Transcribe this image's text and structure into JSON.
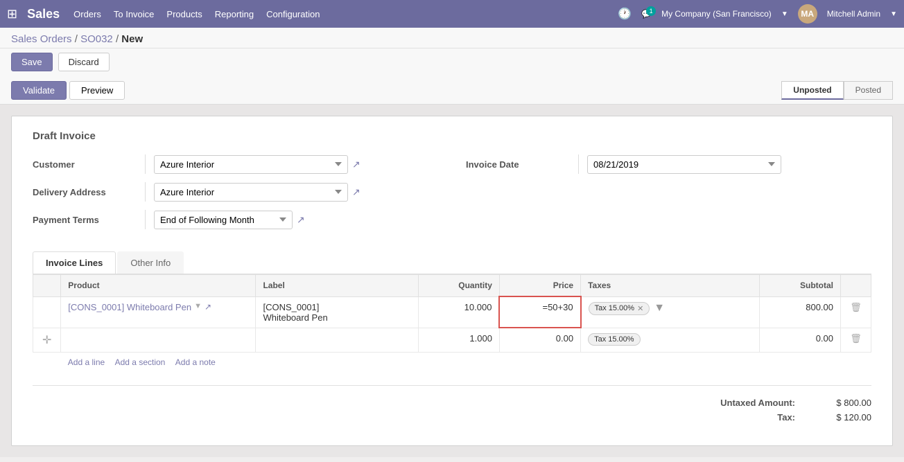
{
  "app": {
    "name": "Sales",
    "grid_icon": "⊞"
  },
  "navbar": {
    "menu_items": [
      "Orders",
      "To Invoice",
      "Products",
      "Reporting",
      "Configuration"
    ],
    "company": "My Company (San Francisco)",
    "user": "Mitchell Admin",
    "chat_badge": "1"
  },
  "breadcrumb": {
    "parts": [
      "Sales Orders",
      "SO032",
      "New"
    ],
    "separators": [
      "/",
      "/"
    ]
  },
  "action_bar": {
    "save_label": "Save",
    "discard_label": "Discard"
  },
  "form_actions": {
    "validate_label": "Validate",
    "preview_label": "Preview"
  },
  "status_bar": {
    "unposted_label": "Unposted",
    "posted_label": "Posted",
    "active": "Unposted"
  },
  "form": {
    "title": "Draft Invoice",
    "customer_label": "Customer",
    "customer_value": "Azure Interior",
    "delivery_address_label": "Delivery Address",
    "delivery_address_value": "Azure Interior",
    "payment_terms_label": "Payment Terms",
    "payment_terms_value": "End of Following Month",
    "invoice_date_label": "Invoice Date",
    "invoice_date_value": "08/21/2019"
  },
  "tabs": [
    {
      "id": "invoice-lines",
      "label": "Invoice Lines",
      "active": true
    },
    {
      "id": "other-info",
      "label": "Other Info",
      "active": false
    }
  ],
  "table": {
    "headers": [
      "Product",
      "Label",
      "Quantity",
      "Price",
      "Taxes",
      "Subtotal"
    ],
    "rows": [
      {
        "product": "[CONS_0001] Whiteboard Pen",
        "label_line1": "[CONS_0001]",
        "label_line2": "Whiteboard Pen",
        "quantity": "10.000",
        "price": "=50+30",
        "taxes": "Tax 15.00%",
        "subtotal": "800.00",
        "price_highlighted": true
      },
      {
        "product": "",
        "label_line1": "",
        "label_line2": "",
        "quantity": "1.000",
        "price": "0.00",
        "taxes": "Tax 15.00%",
        "subtotal": "0.00",
        "price_highlighted": false
      }
    ],
    "add_line": "Add a line",
    "add_section": "Add a section",
    "add_note": "Add a note"
  },
  "totals": {
    "untaxed_amount_label": "Untaxed Amount:",
    "untaxed_amount_value": "$ 800.00",
    "tax_label": "Tax:",
    "tax_value": "$ 120.00"
  }
}
